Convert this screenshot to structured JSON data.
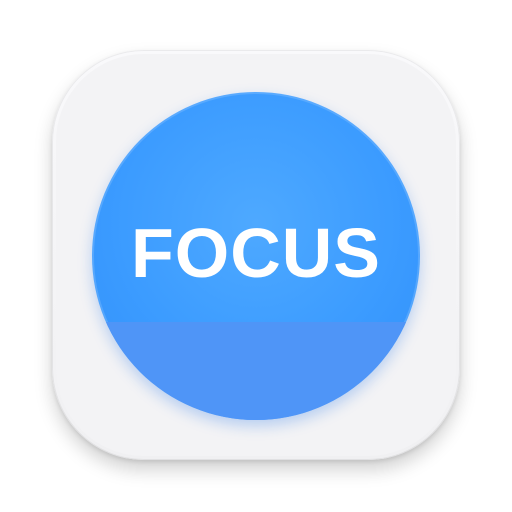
{
  "icon": {
    "label": "FOCUS",
    "colors": {
      "tile": "#f3f3f5",
      "disc": "#3b9bff",
      "disc_lower": "#4f95f7",
      "label": "#ffffff"
    }
  }
}
